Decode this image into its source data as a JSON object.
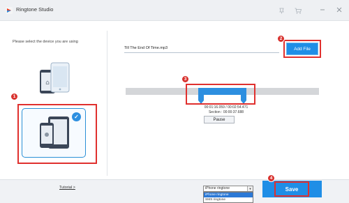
{
  "window": {
    "title": "Ringtone Studio"
  },
  "left_panel": {
    "prompt": "Please select the device you are using"
  },
  "file": {
    "name": "Till The End Of Time.mp3",
    "add_label": "Add File"
  },
  "player": {
    "time_range": "00:01:16.059 / 00:02:54.471",
    "section": "Section : 00:00:37.688",
    "pause_label": "Pause"
  },
  "bottom": {
    "tutorial_label": "Tutorial >",
    "format_selected": "iPhone ringtone",
    "format_options": [
      "iPhone ringtone",
      "SMS ringtone"
    ],
    "save_label": "Save"
  },
  "badges": [
    "1",
    "2",
    "3",
    "4"
  ],
  "icons": [
    "app-logo-icon",
    "pin-icon",
    "cart-icon",
    "minimize-icon",
    "close-icon",
    "check-icon"
  ],
  "colors": {
    "accent": "#1f8ee6",
    "highlight": "#e0302e",
    "badge": "#d8312d"
  }
}
